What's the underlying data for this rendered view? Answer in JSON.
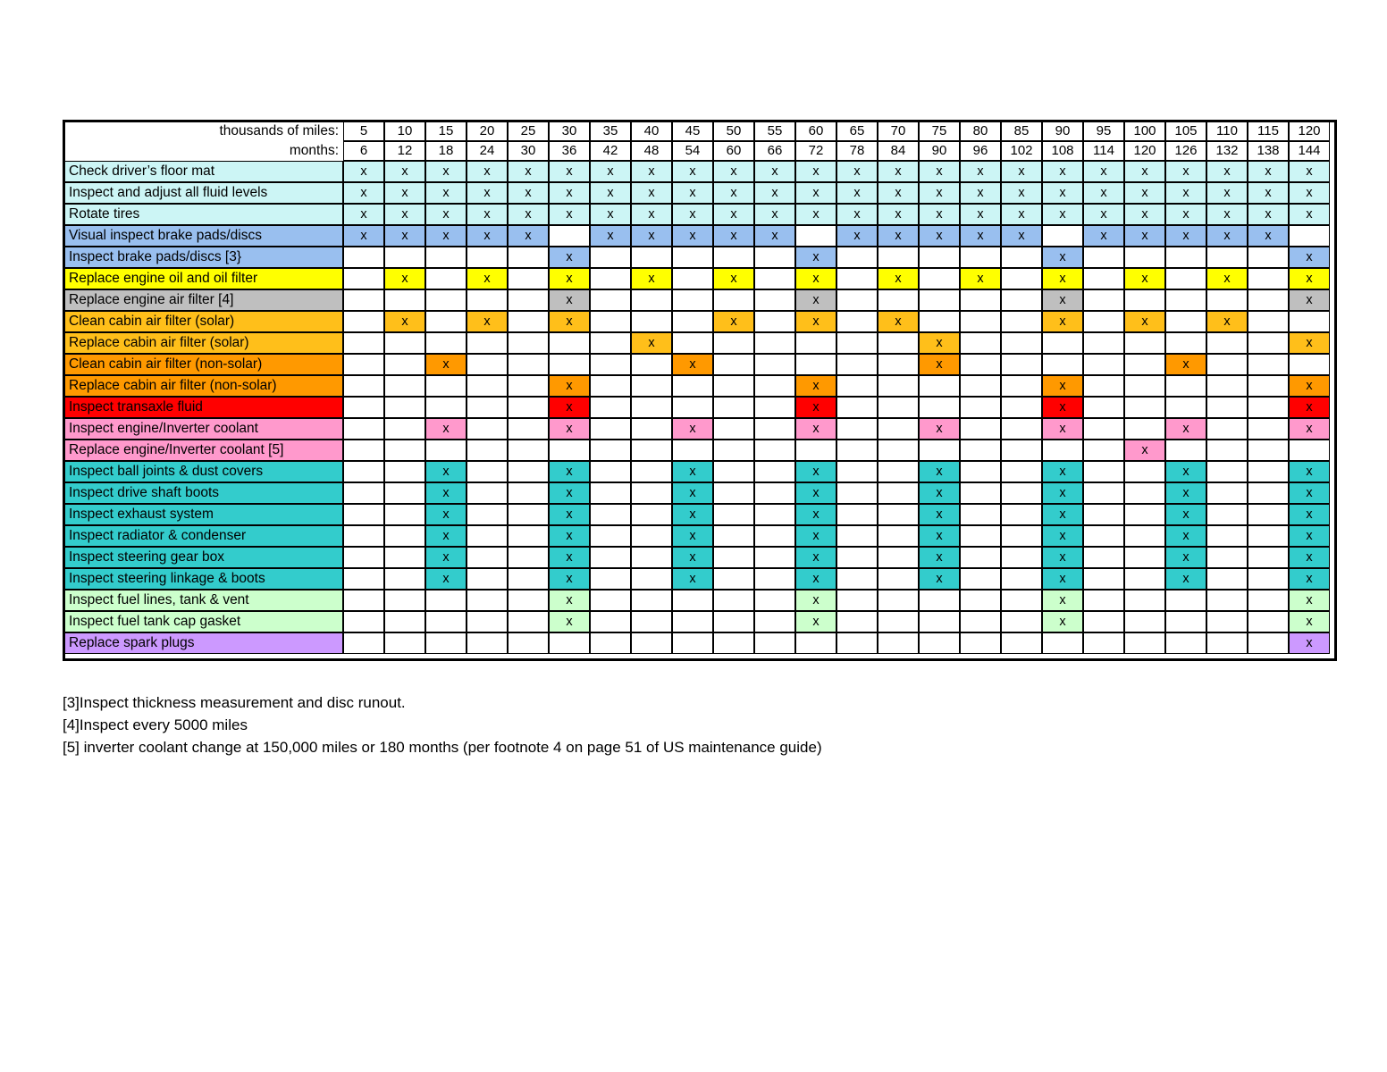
{
  "header": {
    "miles_caption": "thousands of miles:",
    "months_caption": "months:",
    "miles": [
      "5",
      "10",
      "15",
      "20",
      "25",
      "30",
      "35",
      "40",
      "45",
      "50",
      "55",
      "60",
      "65",
      "70",
      "75",
      "80",
      "85",
      "90",
      "95",
      "100",
      "105",
      "110",
      "115",
      "120"
    ],
    "months": [
      "6",
      "12",
      "18",
      "24",
      "30",
      "36",
      "42",
      "48",
      "54",
      "60",
      "66",
      "72",
      "78",
      "84",
      "90",
      "96",
      "102",
      "108",
      "114",
      "120",
      "126",
      "132",
      "138",
      "144"
    ]
  },
  "mark": "x",
  "colors": {
    "cyan": "#CCF5F5",
    "blue": "#99BFEF",
    "yellow": "#FFFF00",
    "gray": "#BFBFBF",
    "amber": "#FFBF1A",
    "orange": "#FF9900",
    "red": "#FF0000",
    "pink": "#FF99CC",
    "teal": "#33CCCC",
    "green": "#CCFFCC",
    "purple": "#CC99FF",
    "white": "#FFFFFF",
    "border": "#000000"
  },
  "rows": [
    {
      "label": "Check driver’s floor mat",
      "color": "#CCF5F5",
      "marks": [
        1,
        1,
        1,
        1,
        1,
        1,
        1,
        1,
        1,
        1,
        1,
        1,
        1,
        1,
        1,
        1,
        1,
        1,
        1,
        1,
        1,
        1,
        1,
        1
      ]
    },
    {
      "label": "Inspect and adjust all fluid levels",
      "color": "#CCF5F5",
      "marks": [
        1,
        1,
        1,
        1,
        1,
        1,
        1,
        1,
        1,
        1,
        1,
        1,
        1,
        1,
        1,
        1,
        1,
        1,
        1,
        1,
        1,
        1,
        1,
        1
      ]
    },
    {
      "label": "Rotate tires",
      "color": "#CCF5F5",
      "marks": [
        1,
        1,
        1,
        1,
        1,
        1,
        1,
        1,
        1,
        1,
        1,
        1,
        1,
        1,
        1,
        1,
        1,
        1,
        1,
        1,
        1,
        1,
        1,
        1
      ]
    },
    {
      "label": "Visual inspect brake pads/discs",
      "color": "#99BFEF",
      "marks": [
        1,
        1,
        1,
        1,
        1,
        0,
        1,
        1,
        1,
        1,
        1,
        0,
        1,
        1,
        1,
        1,
        1,
        0,
        1,
        1,
        1,
        1,
        1,
        0
      ]
    },
    {
      "label": "Inspect brake pads/discs [3}",
      "color": "#99BFEF",
      "marks": [
        0,
        0,
        0,
        0,
        0,
        1,
        0,
        0,
        0,
        0,
        0,
        1,
        0,
        0,
        0,
        0,
        0,
        1,
        0,
        0,
        0,
        0,
        0,
        1
      ]
    },
    {
      "label": "Replace engine oil and oil filter",
      "color": "#FFFF00",
      "marks": [
        0,
        1,
        0,
        1,
        0,
        1,
        0,
        1,
        0,
        1,
        0,
        1,
        0,
        1,
        0,
        1,
        0,
        1,
        0,
        1,
        0,
        1,
        0,
        1
      ]
    },
    {
      "label": "Replace engine air filter [4]",
      "color": "#BFBFBF",
      "marks": [
        0,
        0,
        0,
        0,
        0,
        1,
        0,
        0,
        0,
        0,
        0,
        1,
        0,
        0,
        0,
        0,
        0,
        1,
        0,
        0,
        0,
        0,
        0,
        1
      ]
    },
    {
      "label": "Clean cabin air filter (solar)",
      "color": "#FFBF1A",
      "marks": [
        0,
        1,
        0,
        1,
        0,
        1,
        0,
        0,
        0,
        1,
        0,
        1,
        0,
        1,
        0,
        0,
        0,
        1,
        0,
        1,
        0,
        1,
        0,
        0
      ]
    },
    {
      "label": "Replace cabin air filter (solar)",
      "color": "#FFBF1A",
      "marks": [
        0,
        0,
        0,
        0,
        0,
        0,
        0,
        1,
        0,
        0,
        0,
        0,
        0,
        0,
        1,
        0,
        0,
        0,
        0,
        0,
        0,
        0,
        0,
        1
      ]
    },
    {
      "label": "Clean cabin air filter (non-solar)",
      "color": "#FF9900",
      "marks": [
        0,
        0,
        1,
        0,
        0,
        0,
        0,
        0,
        1,
        0,
        0,
        0,
        0,
        0,
        1,
        0,
        0,
        0,
        0,
        0,
        1,
        0,
        0,
        0
      ]
    },
    {
      "label": "Replace cabin air filter (non-solar)",
      "color": "#FF9900",
      "marks": [
        0,
        0,
        0,
        0,
        0,
        1,
        0,
        0,
        0,
        0,
        0,
        1,
        0,
        0,
        0,
        0,
        0,
        1,
        0,
        0,
        0,
        0,
        0,
        1
      ]
    },
    {
      "label": "Inspect transaxle fluid",
      "color": "#FF0000",
      "marks": [
        0,
        0,
        0,
        0,
        0,
        1,
        0,
        0,
        0,
        0,
        0,
        1,
        0,
        0,
        0,
        0,
        0,
        1,
        0,
        0,
        0,
        0,
        0,
        1
      ]
    },
    {
      "label": "Inspect engine/Inverter coolant",
      "color": "#FF99CC",
      "marks": [
        0,
        0,
        1,
        0,
        0,
        1,
        0,
        0,
        1,
        0,
        0,
        1,
        0,
        0,
        1,
        0,
        0,
        1,
        0,
        0,
        1,
        0,
        0,
        1
      ]
    },
    {
      "label": "Replace engine/Inverter coolant [5]",
      "color": "#FF99CC",
      "marks": [
        0,
        0,
        0,
        0,
        0,
        0,
        0,
        0,
        0,
        0,
        0,
        0,
        0,
        0,
        0,
        0,
        0,
        0,
        0,
        1,
        0,
        0,
        0,
        0
      ]
    },
    {
      "label": "Inspect ball joints & dust covers",
      "color": "#33CCCC",
      "marks": [
        0,
        0,
        1,
        0,
        0,
        1,
        0,
        0,
        1,
        0,
        0,
        1,
        0,
        0,
        1,
        0,
        0,
        1,
        0,
        0,
        1,
        0,
        0,
        1
      ]
    },
    {
      "label": "Inspect drive shaft boots",
      "color": "#33CCCC",
      "marks": [
        0,
        0,
        1,
        0,
        0,
        1,
        0,
        0,
        1,
        0,
        0,
        1,
        0,
        0,
        1,
        0,
        0,
        1,
        0,
        0,
        1,
        0,
        0,
        1
      ]
    },
    {
      "label": "Inspect exhaust system",
      "color": "#33CCCC",
      "marks": [
        0,
        0,
        1,
        0,
        0,
        1,
        0,
        0,
        1,
        0,
        0,
        1,
        0,
        0,
        1,
        0,
        0,
        1,
        0,
        0,
        1,
        0,
        0,
        1
      ]
    },
    {
      "label": "Inspect radiator & condenser",
      "color": "#33CCCC",
      "marks": [
        0,
        0,
        1,
        0,
        0,
        1,
        0,
        0,
        1,
        0,
        0,
        1,
        0,
        0,
        1,
        0,
        0,
        1,
        0,
        0,
        1,
        0,
        0,
        1
      ]
    },
    {
      "label": "Inspect steering gear box",
      "color": "#33CCCC",
      "marks": [
        0,
        0,
        1,
        0,
        0,
        1,
        0,
        0,
        1,
        0,
        0,
        1,
        0,
        0,
        1,
        0,
        0,
        1,
        0,
        0,
        1,
        0,
        0,
        1
      ]
    },
    {
      "label": "Inspect steering linkage & boots",
      "color": "#33CCCC",
      "marks": [
        0,
        0,
        1,
        0,
        0,
        1,
        0,
        0,
        1,
        0,
        0,
        1,
        0,
        0,
        1,
        0,
        0,
        1,
        0,
        0,
        1,
        0,
        0,
        1
      ]
    },
    {
      "label": "Inspect fuel lines, tank & vent",
      "color": "#CCFFCC",
      "marks": [
        0,
        0,
        0,
        0,
        0,
        1,
        0,
        0,
        0,
        0,
        0,
        1,
        0,
        0,
        0,
        0,
        0,
        1,
        0,
        0,
        0,
        0,
        0,
        1
      ]
    },
    {
      "label": "Inspect fuel tank cap gasket",
      "color": "#CCFFCC",
      "marks": [
        0,
        0,
        0,
        0,
        0,
        1,
        0,
        0,
        0,
        0,
        0,
        1,
        0,
        0,
        0,
        0,
        0,
        1,
        0,
        0,
        0,
        0,
        0,
        1
      ]
    },
    {
      "label": "Replace spark plugs",
      "color": "#CC99FF",
      "marks": [
        0,
        0,
        0,
        0,
        0,
        0,
        0,
        0,
        0,
        0,
        0,
        0,
        0,
        0,
        0,
        0,
        0,
        0,
        0,
        0,
        0,
        0,
        0,
        1
      ]
    }
  ],
  "footnotes": [
    "[3]Inspect thickness measurement and disc runout.",
    "[4]Inspect every 5000 miles",
    "[5] inverter coolant change at 150,000 miles or 180 months (per footnote 4 on page 51 of US maintenance guide)"
  ]
}
